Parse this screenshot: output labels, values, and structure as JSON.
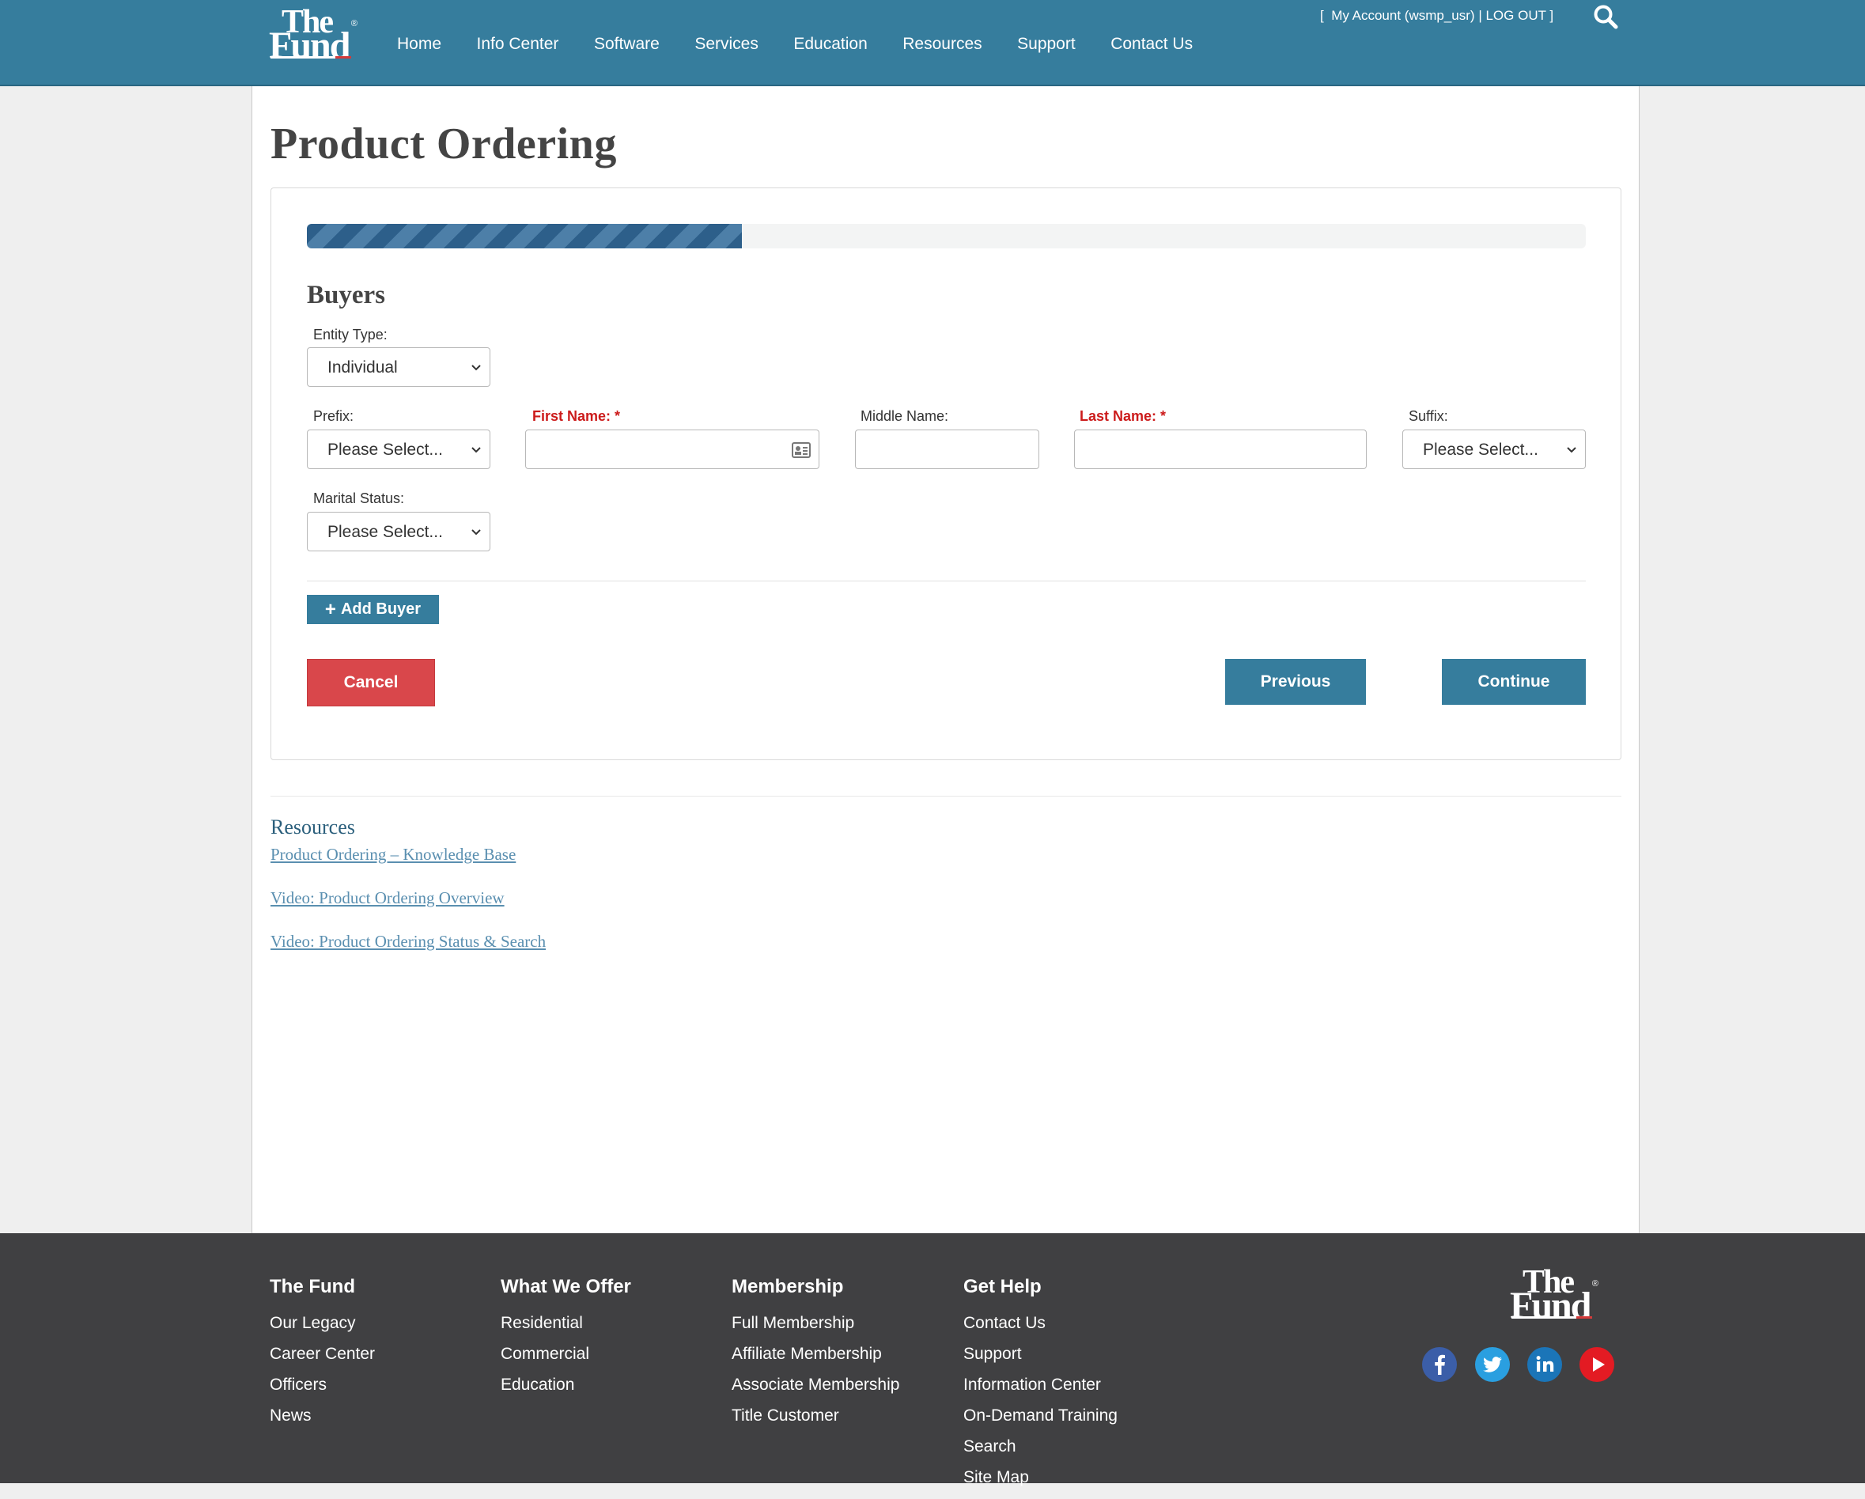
{
  "header": {
    "logo": {
      "line1": "The",
      "line2": "Fund",
      "reg": "®"
    },
    "nav": [
      "Home",
      "Info Center",
      "Software",
      "Services",
      "Education",
      "Resources",
      "Support",
      "Contact Us"
    ],
    "account": {
      "bracket_open": "[",
      "my_account": "My Account (wsmp_usr)",
      "pipe": "|",
      "logout": "LOG OUT",
      "bracket_close": "]"
    },
    "search_icon": "search-icon"
  },
  "page": {
    "title": "Product Ordering",
    "progress_percent": 34
  },
  "form": {
    "section_title": "Buyers",
    "entity_type": {
      "label": "Entity Type:",
      "value": "Individual"
    },
    "prefix": {
      "label": "Prefix:",
      "value": "Please Select..."
    },
    "first_name": {
      "label": "First Name: *",
      "value": ""
    },
    "middle_name": {
      "label": "Middle Name:",
      "value": ""
    },
    "last_name": {
      "label": "Last Name: *",
      "value": ""
    },
    "suffix": {
      "label": "Suffix:",
      "value": "Please Select..."
    },
    "marital_status": {
      "label": "Marital Status:",
      "value": "Please Select..."
    },
    "add_buyer": "Add Buyer",
    "cancel": "Cancel",
    "previous": "Previous",
    "continue": "Continue"
  },
  "resources": {
    "title": "Resources",
    "links": [
      "Product Ordering – Knowledge Base",
      "Video: Product Ordering Overview",
      "Video: Product Ordering Status & Search"
    ]
  },
  "footer": {
    "columns": [
      {
        "title": "The Fund",
        "links": [
          "Our Legacy",
          "Career Center",
          "Officers",
          "News"
        ]
      },
      {
        "title": "What We Offer",
        "links": [
          "Residential",
          "Commercial",
          "Education"
        ]
      },
      {
        "title": "Membership",
        "links": [
          "Full Membership",
          "Affiliate Membership",
          "Associate Membership",
          "Title Customer"
        ]
      },
      {
        "title": "Get Help",
        "links": [
          "Contact Us",
          "Support",
          "Information Center",
          "On-Demand Training",
          "Search",
          "Site Map"
        ]
      }
    ],
    "social": [
      "facebook-icon",
      "twitter-icon",
      "linkedin-icon",
      "youtube-icon"
    ]
  },
  "colors": {
    "header": "#367d9d",
    "primary_button": "#367d9d",
    "cancel_button": "#d9474b",
    "required_label": "#cc1b1b",
    "footer": "#404042",
    "progress": "#2d5f8a"
  }
}
